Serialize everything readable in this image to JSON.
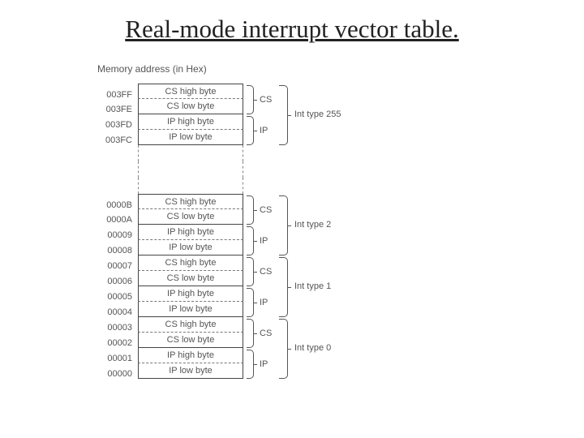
{
  "title": "Real-mode interrupt vector table.",
  "subtitle": "Memory address (in Hex)",
  "rows": {
    "cs_high": "CS high byte",
    "cs_low": "CS low byte",
    "ip_high": "IP high byte",
    "ip_low": "IP low byte"
  },
  "addresses": {
    "g255": [
      "003FF",
      "003FE",
      "003FD",
      "003FC"
    ],
    "g2": [
      "0000B",
      "0000A",
      "00009",
      "00008"
    ],
    "g1": [
      "00007",
      "00006",
      "00005",
      "00004"
    ],
    "g0": [
      "00003",
      "00002",
      "00001",
      "00000"
    ]
  },
  "labels": {
    "cs": "CS",
    "ip": "IP",
    "int255": "Int type 255",
    "int2": "Int type 2",
    "int1": "Int type 1",
    "int0": "Int type 0"
  }
}
